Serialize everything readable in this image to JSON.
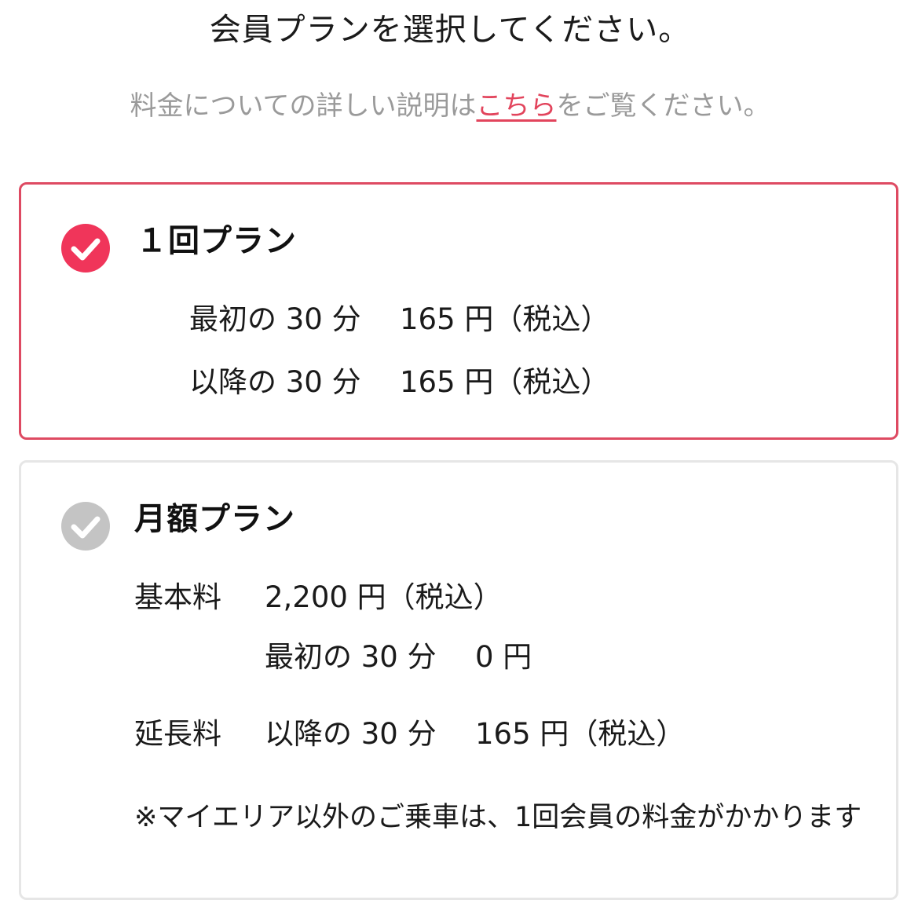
{
  "header": {
    "title": "会員プランを選択してください。",
    "subtitle_before": "料金についての詳しい説明は",
    "subtitle_link": "こちら",
    "subtitle_after": "をご覧ください。"
  },
  "plans": [
    {
      "name": "１回プラン",
      "selected": true,
      "check_color": "#f0355a",
      "rows": [
        {
          "label": "最初の 30 分",
          "price": "165 円（税込）"
        },
        {
          "label": "以降の 30 分",
          "price": "165 円（税込）"
        }
      ]
    },
    {
      "name": "月額プラン",
      "selected": false,
      "check_color": "#c4c4c4",
      "basic_label": "基本料",
      "basic_price": "2,200 円（税込）",
      "basic_sub_label": "最初の 30 分",
      "basic_sub_price": "0 円",
      "ext_label": "延長料",
      "ext_sub_label": "以降の 30 分",
      "ext_sub_price": "165 円（税込）",
      "note": "※マイエリア以外のご乗車は、1回会員の料金がかかります"
    }
  ],
  "colors": {
    "accent": "#e2445c",
    "selected_border": "#de4a62",
    "unselected_border": "#e6e6e6",
    "muted_text": "#9a9a9a"
  }
}
